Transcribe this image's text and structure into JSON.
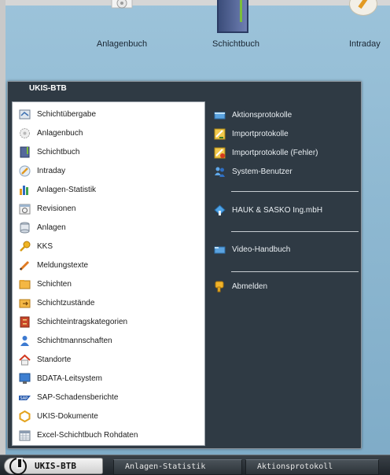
{
  "desktop": {
    "icons": [
      {
        "label": "Anlagenbuch",
        "icon": "gear-book-icon"
      },
      {
        "label": "Schichtbuch",
        "icon": "book-icon"
      },
      {
        "label": "Intraday",
        "icon": "pencil-clock-icon"
      }
    ]
  },
  "menu": {
    "title": "UKIS-BTB",
    "left_items": [
      {
        "label": "Schichtübergabe",
        "icon": "handover-icon"
      },
      {
        "label": "Anlagenbuch",
        "icon": "gear-icon"
      },
      {
        "label": "Schichtbuch",
        "icon": "book-icon"
      },
      {
        "label": "Intraday",
        "icon": "pencil-icon"
      },
      {
        "label": "Anlagen-Statistik",
        "icon": "bar-chart-icon"
      },
      {
        "label": "Revisionen",
        "icon": "calendar-icon"
      },
      {
        "label": "Anlagen",
        "icon": "database-icon"
      },
      {
        "label": "KKS",
        "icon": "key-icon"
      },
      {
        "label": "Meldungstexte",
        "icon": "pencil-icon"
      },
      {
        "label": "Schichten",
        "icon": "folder-icon"
      },
      {
        "label": "Schichtzustände",
        "icon": "folder-arrow-icon"
      },
      {
        "label": "Schichteintragskategorien",
        "icon": "cabinet-icon"
      },
      {
        "label": "Schichtmannschaften",
        "icon": "person-icon"
      },
      {
        "label": "Standorte",
        "icon": "house-icon"
      },
      {
        "label": "BDATA-Leitsystem",
        "icon": "monitor-icon"
      },
      {
        "label": "SAP-Schadensberichte",
        "icon": "sap-icon"
      },
      {
        "label": "UKIS-Dokumente",
        "icon": "hexagon-icon"
      },
      {
        "label": "Excel-Schichtbuch Rohdaten",
        "icon": "spreadsheet-icon"
      }
    ],
    "right_items": [
      {
        "label": "Aktionsprotokolle",
        "icon": "log-icon"
      },
      {
        "label": "Importprotokolle",
        "icon": "import-icon"
      },
      {
        "label": "Importprotokolle (Fehler)",
        "icon": "import-error-icon"
      },
      {
        "label": "System-Benutzer",
        "icon": "users-icon"
      },
      {
        "label": "HAUK & SASKO Ing.mbH",
        "icon": "company-icon"
      },
      {
        "label": "Video-Handbuch",
        "icon": "video-icon"
      },
      {
        "label": "Abmelden",
        "icon": "logout-key-icon"
      }
    ]
  },
  "taskbar": {
    "start_label": "UKIS-BTB",
    "tasks": [
      "Anlagen-Statistik",
      "Aktionsprotokoll"
    ]
  }
}
